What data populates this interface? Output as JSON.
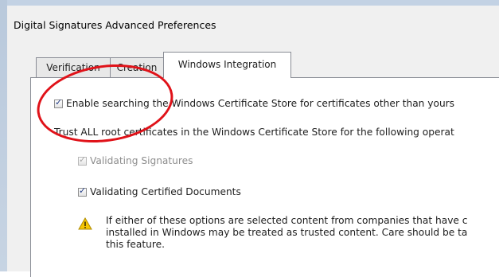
{
  "dialog": {
    "title": "Digital Signatures Advanced Preferences",
    "tabs": [
      {
        "label": "Verification"
      },
      {
        "label": "Creation"
      },
      {
        "label": "Windows Integration"
      }
    ]
  },
  "windows_integration": {
    "enable_search_label": "Enable searching the Windows Certificate Store for certificates other than yours",
    "enable_search_checked": true,
    "trust_heading": "Trust ALL root certificates in the Windows Certificate Store for the following operat",
    "validating_signatures_label": "Validating Signatures",
    "validating_signatures_checked": true,
    "validating_signatures_disabled": true,
    "validating_certified_label": "Validating Certified Documents",
    "validating_certified_checked": true,
    "warning_lines": [
      "If either of these options are selected content from companies that have c",
      "installed in Windows may be treated as trusted content. Care should be ta",
      "this feature."
    ]
  },
  "colors": {
    "annotation": "#e01219",
    "warning_yellow": "#f6c500"
  },
  "icons": {
    "warning": "warning-icon"
  }
}
